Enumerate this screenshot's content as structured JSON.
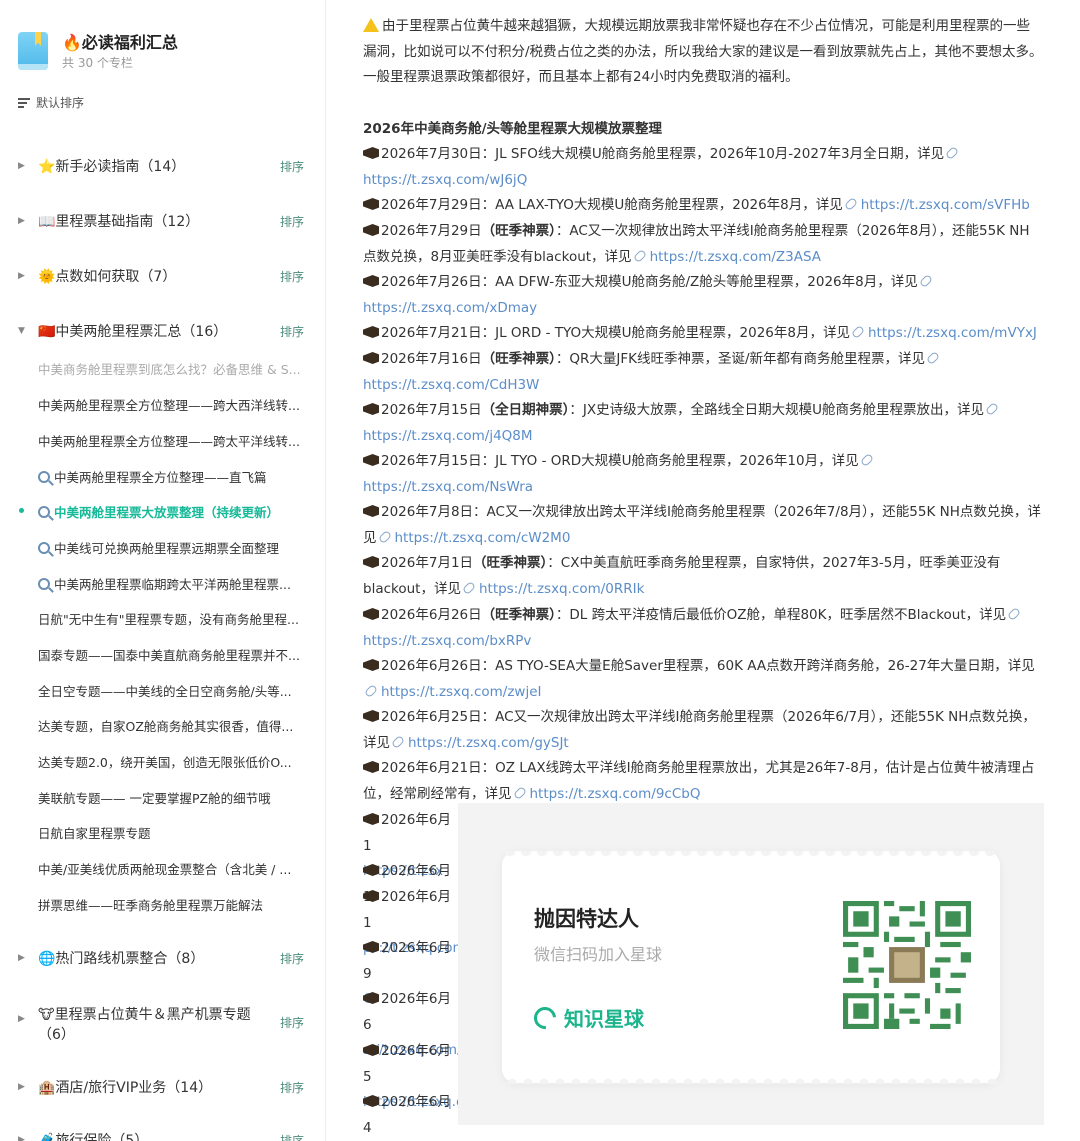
{
  "sidebar": {
    "title": "🔥必读福利汇总",
    "subtitle": "共 30 个专栏",
    "sort_label": "默认排序",
    "rank_label": "排序",
    "categories": [
      {
        "label": "⭐新手必读指南（14）"
      },
      {
        "label": "📖里程票基础指南（12）"
      },
      {
        "label": "🌞点数如何获取（7）"
      },
      {
        "label": "🇨🇳中美两舱里程票汇总（16）"
      },
      {
        "label": "🌐热门路线机票整合（8）"
      },
      {
        "label": "🐮里程票占位黄牛＆黑产机票专题",
        "label2": "（6）"
      },
      {
        "label": "🏨酒店/旅行VIP业务（14）"
      },
      {
        "label": "🧳旅行保险（5）"
      }
    ],
    "sub_items": [
      "中美商务舱里程票到底怎么找？必备思维 & S...",
      "中美两舱里程票全方位整理——跨大西洋线转...",
      "中美两舱里程票全方位整理——跨太平洋线转...",
      "中美两舱里程票全方位整理——直飞篇",
      "中美两舱里程票大放票整理（持续更新）",
      "中美线可兑换两舱里程票远期票全面整理",
      "中美两舱里程票临期跨太平洋两舱里程票...",
      "日航\"无中生有\"里程票专题，没有商务舱里程...",
      "国泰专题——国泰中美直航商务舱里程票并不...",
      "全日空专题——中美线的全日空商务舱/头等...",
      "达美专题，自家OZ舱商务舱其实很香，值得...",
      "达美专题2.0，绕开美国，创造无限张低价O...",
      "美联航专题—— 一定要掌握PZ舱的细节哦",
      "日航自家里程票专题",
      "中美/亚美线优质两舱现金票整合（含北美 / ...",
      "拼票思维——旺季商务舱里程票万能解法"
    ]
  },
  "main": {
    "intro": "由于里程票占位黄牛越来越猖獗，大规模远期放票我非常怀疑也存在不少占位情况，可能是利用里程票的一些漏洞，比如说可以不付积分/税费占位之类的办法，所以我给大家的建议是一看到放票就先占上，其他不要想太多。一般里程票退票政策都很好，而且基本上都有24小时内免费取消的福利。",
    "section_title": "2026年中美商务舱/头等舱里程票大规模放票整理",
    "entries": [
      {
        "date": "2026年7月30日：",
        "tag": "",
        "text": "JL SFO线大规模U舱商务舱里程票，2026年10月-2027年3月全日期，详见",
        "link": "https://t.zsxq.com/wJ6jQ"
      },
      {
        "date": "2026年7月29日：",
        "tag": "",
        "text": "AA LAX-TYO大规模U舱商务舱里程票，2026年8月，详见",
        "link": "https://t.zsxq.com/sVFHb"
      },
      {
        "date": "2026年7月29日",
        "tag": "（旺季神票）",
        "text": "：AC又一次规律放出跨太平洋线I舱商务舱里程票（2026年8月），还能55K NH点数兑换，8月亚美旺季没有blackout，详见",
        "link": "https://t.zsxq.com/Z3ASA"
      },
      {
        "date": "2026年7月26日：",
        "tag": "",
        "text": "AA DFW-东亚大规模U舱商务舱/Z舱头等舱里程票，2026年8月，详见",
        "link": "https://t.zsxq.com/xDmay"
      },
      {
        "date": "2026年7月21日：",
        "tag": "",
        "text": "JL ORD - TYO大规模U舱商务舱里程票，2026年8月，详见",
        "link": "https://t.zsxq.com/mVYxJ"
      },
      {
        "date": "2026年7月16日",
        "tag": "（旺季神票）",
        "text": "：QR大量JFK线旺季神票，圣诞/新年都有商务舱里程票，详见",
        "link": "https://t.zsxq.com/CdH3W"
      },
      {
        "date": "2026年7月15日",
        "tag": "（全日期神票）",
        "text": "：JX史诗级大放票，全路线全日期大规模U舱商务舱里程票放出，详见",
        "link": "https://t.zsxq.com/j4Q8M"
      },
      {
        "date": "2026年7月15日：",
        "tag": "",
        "text": "JL TYO - ORD大规模U舱商务舱里程票，2026年10月，详见",
        "link": "https://t.zsxq.com/NsWra"
      },
      {
        "date": "2026年7月8日：",
        "tag": "",
        "text": "AC又一次规律放出跨太平洋线I舱商务舱里程票（2026年7/8月），还能55K NH点数兑换，详见",
        "link": "https://t.zsxq.com/cW2M0"
      },
      {
        "date": "2026年7月1日",
        "tag": "（旺季神票）",
        "text": "：CX中美直航旺季商务舱里程票，自家特供，2027年3-5月，旺季美亚没有blackout，详见",
        "link": "https://t.zsxq.com/0RRIk"
      },
      {
        "date": "2026年6月26日",
        "tag": "（旺季神票）",
        "text": "：DL 跨太平洋疫情后最低价OZ舱，单程80K，旺季居然不Blackout，详见",
        "link": "https://t.zsxq.com/bxRPv"
      },
      {
        "date": "2026年6月26日：",
        "tag": "",
        "text": "AS TYO-SEA大量E舱Saver里程票，60K AA点数开跨洋商务舱，26-27年大量日期，详见",
        "link": "https://t.zsxq.com/zwjeI"
      },
      {
        "date": "2026年6月25日：",
        "tag": "",
        "text": "AC又一次规律放出跨太平洋线I舱商务舱里程票（2026年6/7月），还能55K NH点数兑换，详见",
        "link": "https://t.zsxq.com/gySJt"
      },
      {
        "date": "2026年6月21日：",
        "tag": "",
        "text": "OZ LAX线跨太平洋线I舱商务舱里程票放出，尤其是26年7-8月，估计是占位黄牛被清理占位，经常刷经常有，详见",
        "link": "https://t.zsxq.com/9cCbQ"
      }
    ],
    "partial_lines": [
      {
        "text": "2026年6月1",
        "cont": "https://t.zsx"
      },
      {
        "text": "2026年6月1",
        "cont": ""
      },
      {
        "text": "2026年6月1",
        "cont": "ps://t.zsxq.com"
      },
      {
        "text": "2026年6月9",
        "cont": "G"
      },
      {
        "text": "2026年6月6",
        "cont": "s://t.zsxq.com/"
      },
      {
        "text": "2026年6月5",
        "cont": "https://t.zsxq.co"
      },
      {
        "text": "2026年6月4",
        "cont": "JRkYX"
      }
    ]
  },
  "overlay": {
    "name": "抛因特达人",
    "hint": "微信扫码加入星球",
    "brand": "知识星球"
  },
  "colors": {
    "accent": "#16b998",
    "link": "#5b8dc9",
    "rank": "#4c8c7c"
  }
}
